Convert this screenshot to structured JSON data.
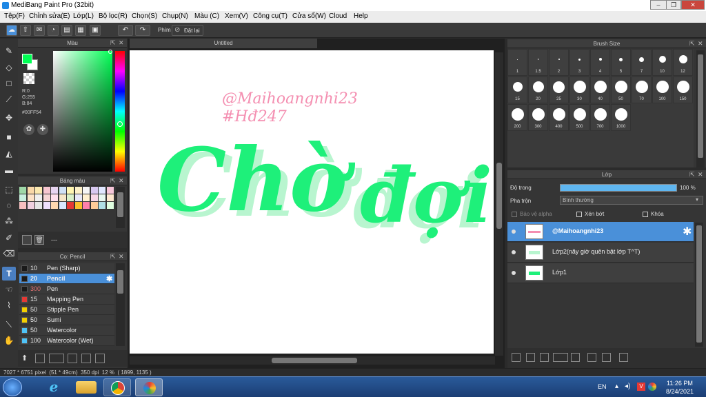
{
  "window": {
    "title": "MediBang Paint Pro (32bit)"
  },
  "menu": [
    "Tệp(F)",
    "Chỉnh sửa(E)",
    "Lớp(L)",
    "Bộ lọc(R)",
    "Chọn(S)",
    "Chụp(N)",
    "Màu (C)",
    "Xem(V)",
    "Công cụ(T)",
    "Cửa sổ(W)",
    "Cloud",
    "Help"
  ],
  "toolbar": {
    "key_label": "Phím",
    "reset_label": "Đặt lại"
  },
  "color_panel": {
    "title": "Màu",
    "r": "R:0",
    "g": "G:255",
    "b": "B:84",
    "hex": "#00FF54",
    "fg_color": "#00ff54",
    "bg_color": "#ffffff"
  },
  "palette_panel": {
    "title": "Bảng màu",
    "name": "---"
  },
  "brush_list": {
    "title": "Cọ: Pencil",
    "items": [
      {
        "size": "10",
        "name": "Pen (Sharp)",
        "color": "#1a1a1a"
      },
      {
        "size": "20",
        "name": "Pencil",
        "color": "#1a1a1a",
        "selected": true
      },
      {
        "size": "300",
        "name": "Pen",
        "color": "#1a1a1a"
      },
      {
        "size": "15",
        "name": "Mapping Pen",
        "color": "#e53935"
      },
      {
        "size": "50",
        "name": "Stipple Pen",
        "color": "#f5d000"
      },
      {
        "size": "50",
        "name": "Sumi",
        "color": "#f5d000"
      },
      {
        "size": "50",
        "name": "Watercolor",
        "color": "#4fc3f7"
      },
      {
        "size": "100",
        "name": "Watercolor (Wet)",
        "color": "#4fc3f7"
      }
    ]
  },
  "canvas": {
    "tab_title": "Untitled",
    "watermark_line1": "@Maihoangnhi23",
    "watermark_line2": "#Hđ247",
    "main_text_1": "Chờ",
    "main_text_2": "đợi",
    "text_color": "#1ef07a",
    "watermark_color": "#f48fb1"
  },
  "brush_size_panel": {
    "title": "Brush Size",
    "sizes": [
      "1",
      "1.5",
      "2",
      "3",
      "4",
      "5",
      "7",
      "10",
      "12",
      "15",
      "20",
      "25",
      "30",
      "40",
      "50",
      "70",
      "100",
      "150",
      "200",
      "300",
      "400",
      "500",
      "700",
      "1000"
    ]
  },
  "layer_panel": {
    "title": "Lớp",
    "opacity_label": "Độ trong",
    "opacity_value": "100 %",
    "blend_label": "Pha trộn",
    "blend_value": "Bình thường",
    "protect_alpha": "Bảo vệ alpha",
    "clipping": "Xén bớt",
    "lock": "Khóa",
    "layers": [
      "@Maihoangnhi23",
      "Lớp2(nãy giờ quên bật lớp T^T)",
      "Lớp1"
    ]
  },
  "status": {
    "text": "7027 * 6751 pixel  (51 * 49cm)  350 dpi  12 %  ( 1899, 1135 )"
  },
  "taskbar": {
    "lang": "EN",
    "time": "11:26 PM",
    "date": "8/24/2021"
  }
}
